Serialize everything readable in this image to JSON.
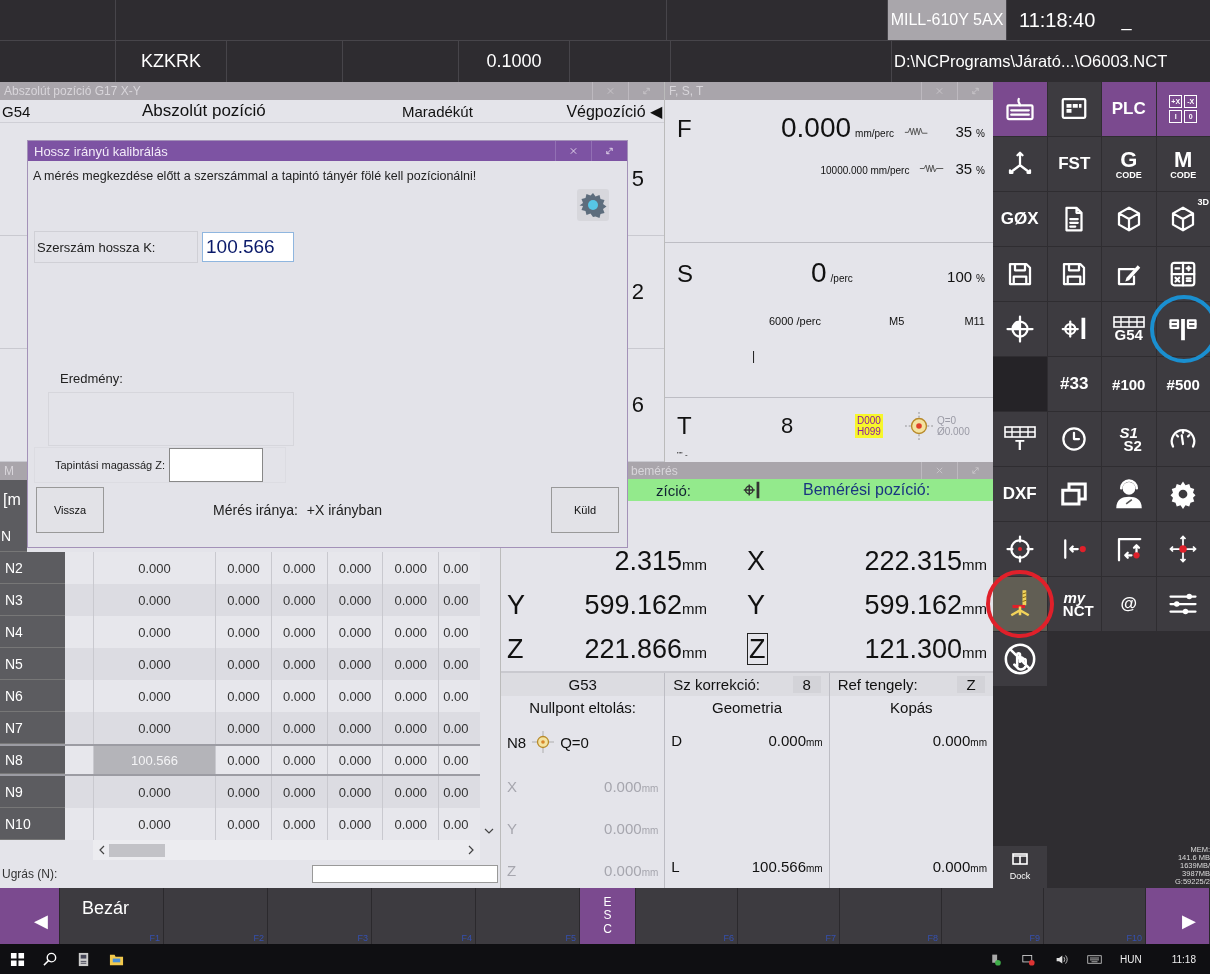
{
  "top_bar": {
    "machine": "MILL-610Y 5AX",
    "time": "11:18:40",
    "minimize": "_",
    "mode": "KZKRK",
    "step": "0.1000",
    "program_path": "D:\\NCPrograms\\Járató...\\O6003.NCT"
  },
  "abs_window": {
    "title": "Abszolút pozíció G17 X-Y",
    "columns": [
      "G54",
      "Abszolút pozíció",
      "Maradékút",
      "Végpozíció ◀"
    ],
    "visible_digits": [
      "5",
      "2",
      "6"
    ]
  },
  "fst_window": {
    "title": "F, S, T",
    "f": {
      "letter": "F",
      "value": "0.000",
      "unit": "mm/perc",
      "override": "35",
      "pct": "%",
      "max": "10000.000 mm/perc",
      "override2": "35",
      "pct2": "%"
    },
    "s": {
      "letter": "S",
      "value": "0",
      "unit": "/perc",
      "override": "100",
      "pct": "%",
      "max": "6000 /perc",
      "m1": "M5",
      "m2": "M11",
      "mark": "|"
    },
    "t": {
      "letter": "T",
      "value": "8",
      "badge": [
        "D000",
        "H099"
      ],
      "q": "Q=0",
      "dia": "Ø0.000",
      "note": "\"\" -"
    }
  },
  "dialog": {
    "title": "Hossz irányú kalibrálás",
    "message": "A mérés megkezdése előtt a szerszámmal a tapintó tányér fölé kell pozícionálni!",
    "length_label": "Szerszám hossza K:",
    "length_value": "100.566",
    "result_label": "Eredmény:",
    "z_label": "Tapintási magasság Z:",
    "back_button": "Vissza",
    "direction_label": "Mérés iránya:",
    "direction_value": "+X irányban",
    "send_button": "Küld"
  },
  "table_window": {
    "title": "M",
    "header": "[m",
    "rows": [
      {
        "name": "N",
        "selected": false
      },
      {
        "name": "N2",
        "cells": [
          "0.000",
          "0.000",
          "0.000",
          "0.000",
          "0.000",
          "0.00"
        ],
        "selected": false
      },
      {
        "name": "N3",
        "cells": [
          "0.000",
          "0.000",
          "0.000",
          "0.000",
          "0.000",
          "0.00"
        ],
        "selected": false
      },
      {
        "name": "N4",
        "cells": [
          "0.000",
          "0.000",
          "0.000",
          "0.000",
          "0.000",
          "0.00"
        ],
        "selected": false
      },
      {
        "name": "N5",
        "cells": [
          "0.000",
          "0.000",
          "0.000",
          "0.000",
          "0.000",
          "0.00"
        ],
        "selected": false
      },
      {
        "name": "N6",
        "cells": [
          "0.000",
          "0.000",
          "0.000",
          "0.000",
          "0.000",
          "0.00"
        ],
        "selected": false
      },
      {
        "name": "N7",
        "cells": [
          "0.000",
          "0.000",
          "0.000",
          "0.000",
          "0.000",
          "0.00"
        ],
        "selected": false
      },
      {
        "name": "N8",
        "cells": [
          "100.566",
          "0.000",
          "0.000",
          "0.000",
          "0.000",
          "0.00"
        ],
        "selected": true
      },
      {
        "name": "N9",
        "cells": [
          "0.000",
          "0.000",
          "0.000",
          "0.000",
          "0.000",
          "0.00"
        ],
        "selected": false
      },
      {
        "name": "N10",
        "cells": [
          "0.000",
          "0.000",
          "0.000",
          "0.000",
          "0.000",
          "0.00"
        ],
        "selected": false
      }
    ],
    "jump_label": "Ugrás (N):"
  },
  "measure_window": {
    "title": "bemérés",
    "header_left": "zíció:",
    "header_right": "Bemérési pozíció:",
    "rows": [
      {
        "value": "2.315",
        "unit": "mm",
        "axis2": "X",
        "boxed": false,
        "value2": "222.315",
        "unit2": "mm"
      },
      {
        "axis": "Y",
        "value": "599.162",
        "unit": "mm",
        "axis2": "Y",
        "boxed": false,
        "value2": "599.162",
        "unit2": "mm"
      },
      {
        "axis": "Z",
        "value": "221.866",
        "unit": "mm",
        "axis2": "Z",
        "boxed": true,
        "value2": "121.300",
        "unit2": "mm"
      }
    ],
    "offset": {
      "code": "G53",
      "title": "Nullpont eltolás:",
      "n": "N8",
      "q": "Q=0",
      "axes": [
        {
          "axis": "X",
          "value": "0.000",
          "unit": "mm"
        },
        {
          "axis": "Y",
          "value": "0.000",
          "unit": "mm"
        },
        {
          "axis": "Z",
          "value": "0.000",
          "unit": "mm"
        }
      ]
    },
    "geometry": {
      "label": "Sz korrekció:",
      "value": "8",
      "title": "Geometria",
      "d": "D",
      "d_value": "0.000",
      "d_unit": "mm",
      "l": "L",
      "l_value": "100.566",
      "l_unit": "mm"
    },
    "wear": {
      "label": "Ref tengely:",
      "value": "Z",
      "title": "Kopás",
      "d_value": "0.000",
      "d_unit": "mm",
      "l_value": "0.000",
      "l_unit": "mm"
    }
  },
  "icon_panel": {
    "tiles": [
      {
        "kind": "icon",
        "highlighted": true,
        "active": false
      },
      {
        "kind": "icon",
        "highlighted": false,
        "active": false
      },
      {
        "kind": "text",
        "label": "PLC",
        "highlighted": true,
        "active": false
      },
      {
        "kind": "keypad",
        "labels": [
          "+X",
          "-X",
          "I",
          "0"
        ],
        "highlighted": true,
        "active": false
      },
      {
        "kind": "icon",
        "highlighted": false,
        "active": false
      },
      {
        "kind": "text",
        "label": "FST",
        "highlighted": false,
        "active": false
      },
      {
        "kind": "code",
        "letter": "G",
        "sub": "CODE",
        "highlighted": false,
        "active": false
      },
      {
        "kind": "code",
        "letter": "M",
        "sub": "CODE",
        "highlighted": false,
        "active": false
      },
      {
        "kind": "text",
        "label": "GØX",
        "highlighted": false,
        "active": false
      },
      {
        "kind": "icon",
        "highlighted": false,
        "active": false
      },
      {
        "kind": "icon",
        "highlighted": false,
        "active": false
      },
      {
        "kind": "icon",
        "badge": "3D",
        "highlighted": false,
        "active": false
      },
      {
        "kind": "icon",
        "highlighted": false,
        "active": false
      },
      {
        "kind": "icon",
        "highlighted": false,
        "active": false
      },
      {
        "kind": "icon",
        "highlighted": false,
        "active": false
      },
      {
        "kind": "icon",
        "highlighted": false,
        "active": false
      },
      {
        "kind": "icon",
        "highlighted": false,
        "active": false
      },
      {
        "kind": "icon",
        "highlighted": false,
        "active": false
      },
      {
        "kind": "grid",
        "label": "G54",
        "highlighted": false,
        "active": false
      },
      {
        "kind": "icon",
        "highlighted": false,
        "active": false,
        "color": "#1a8fd0"
      },
      {
        "kind": "blank"
      },
      {
        "kind": "text",
        "label": "#33",
        "highlighted": false,
        "active": false
      },
      {
        "kind": "text",
        "label": "#100",
        "highlighted": false,
        "active": false
      },
      {
        "kind": "text",
        "label": "#500",
        "highlighted": false,
        "active": false
      },
      {
        "kind": "grid",
        "label": "T",
        "highlighted": false,
        "active": false
      },
      {
        "kind": "icon",
        "highlighted": false,
        "active": false
      },
      {
        "kind": "stack",
        "lines": [
          "S1",
          "S2"
        ],
        "highlighted": false,
        "active": false
      },
      {
        "kind": "icon",
        "highlighted": false,
        "active": false
      },
      {
        "kind": "text",
        "label": "DXF",
        "highlighted": false,
        "active": false
      },
      {
        "kind": "icon",
        "highlighted": false,
        "active": false
      },
      {
        "kind": "icon",
        "highlighted": false,
        "active": false
      },
      {
        "kind": "icon",
        "highlighted": false,
        "active": false
      },
      {
        "kind": "icon",
        "highlighted": false,
        "active": false
      },
      {
        "kind": "icon",
        "highlighted": false,
        "active": false
      },
      {
        "kind": "icon",
        "highlighted": false,
        "active": false
      },
      {
        "kind": "icon",
        "highlighted": false,
        "active": false
      },
      {
        "kind": "icon",
        "highlighted": false,
        "active": true,
        "color": "#e0202a"
      },
      {
        "kind": "stack",
        "lines": [
          "my",
          "NCT"
        ],
        "highlighted": false,
        "active": false
      },
      {
        "kind": "text",
        "label": "@",
        "highlighted": false,
        "active": false
      },
      {
        "kind": "icon",
        "highlighted": false,
        "active": false
      },
      {
        "kind": "icon",
        "highlighted": false,
        "active": false
      }
    ],
    "dock": "Dock",
    "memory": [
      "MEM:",
      "141.6 MB",
      "1639MB/",
      "3987MB",
      "G:59225/2"
    ]
  },
  "function_bar": [
    {
      "kind": "arrow",
      "label": "◀"
    },
    {
      "kind": "key",
      "label": "Bezár",
      "fkey": "F1"
    },
    {
      "kind": "key",
      "fkey": "F2"
    },
    {
      "kind": "key",
      "fkey": "F3"
    },
    {
      "kind": "key",
      "fkey": "F4"
    },
    {
      "kind": "key",
      "fkey": "F5"
    },
    {
      "kind": "esc",
      "label": "ESC"
    },
    {
      "kind": "key",
      "fkey": "F6"
    },
    {
      "kind": "key",
      "fkey": "F7"
    },
    {
      "kind": "key",
      "fkey": "F8"
    },
    {
      "kind": "key",
      "fkey": "F9"
    },
    {
      "kind": "key",
      "fkey": "F10"
    },
    {
      "kind": "arrow",
      "label": "▶"
    }
  ],
  "taskbar": {
    "language": "HUN",
    "clock": "11:18"
  }
}
